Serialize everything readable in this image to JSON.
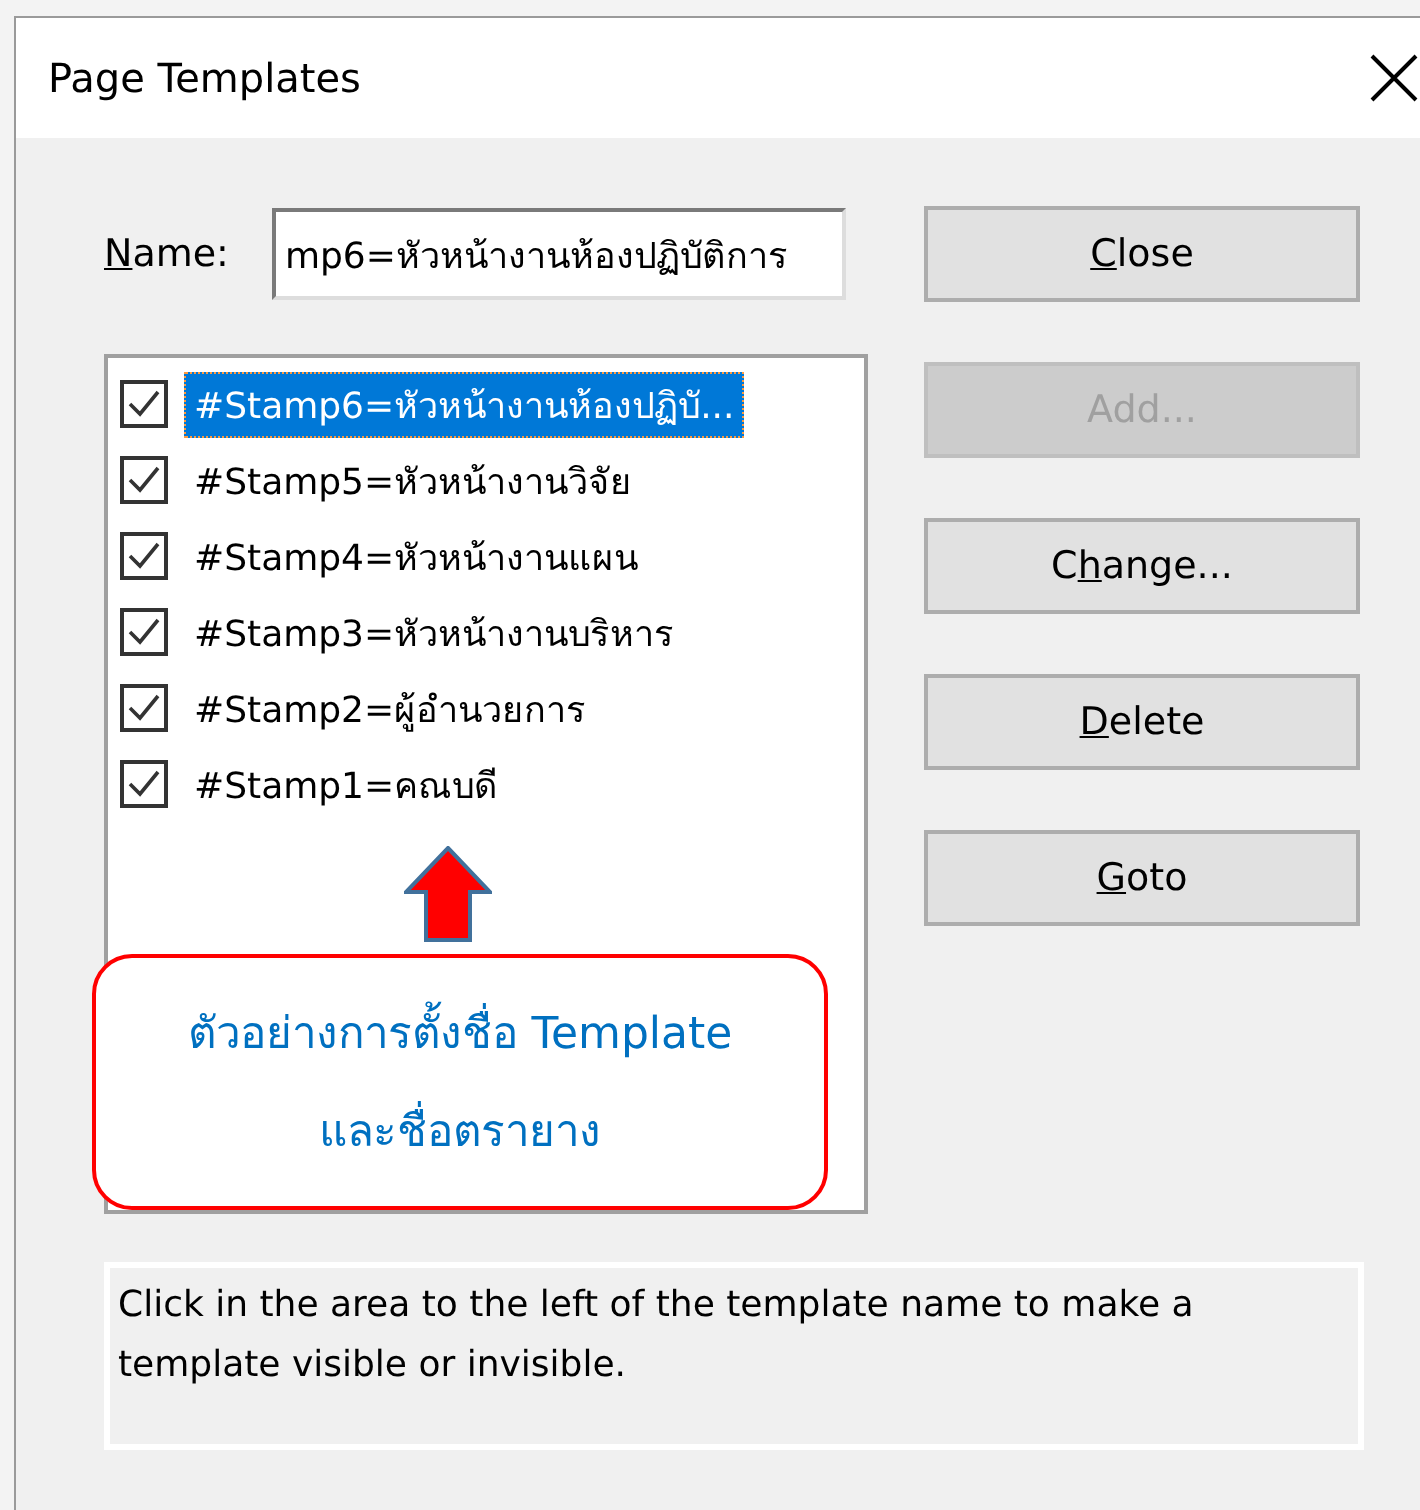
{
  "window": {
    "title": "Page Templates"
  },
  "name_field": {
    "label_parts": [
      {
        "text": "N",
        "underlined": true
      },
      {
        "text": "ame:",
        "underlined": false
      }
    ],
    "value": "mp6=หัวหน้างานห้องปฏิบัติการ"
  },
  "templates": [
    {
      "label": "#Stamp6=หัวหน้างานห้องปฏิบั...",
      "checked": true,
      "selected": true
    },
    {
      "label": "#Stamp5=หัวหน้างานวิจัย",
      "checked": true,
      "selected": false
    },
    {
      "label": "#Stamp4=หัวหน้างานแผน",
      "checked": true,
      "selected": false
    },
    {
      "label": "#Stamp3=หัวหน้างานบริหาร",
      "checked": true,
      "selected": false
    },
    {
      "label": "#Stamp2=ผู้อำนวยการ",
      "checked": true,
      "selected": false
    },
    {
      "label": "#Stamp1=คณบดี",
      "checked": true,
      "selected": false
    }
  ],
  "buttons": [
    {
      "label_parts": [
        {
          "text": "C",
          "underlined": true
        },
        {
          "text": "lose",
          "underlined": false
        }
      ],
      "disabled": false
    },
    {
      "label_parts": [
        {
          "text": "Add...",
          "underlined": false
        }
      ],
      "disabled": true
    },
    {
      "label_parts": [
        {
          "text": "C",
          "underlined": false
        },
        {
          "text": "h",
          "underlined": true
        },
        {
          "text": "ange...",
          "underlined": false
        }
      ],
      "disabled": false
    },
    {
      "label_parts": [
        {
          "text": "D",
          "underlined": true
        },
        {
          "text": "elete",
          "underlined": false
        }
      ],
      "disabled": false
    },
    {
      "label_parts": [
        {
          "text": "G",
          "underlined": true
        },
        {
          "text": "oto",
          "underlined": false
        }
      ],
      "disabled": false
    }
  ],
  "annotation": {
    "lines": [
      "ตัวอย่างการตั้งชื่อ Template",
      "และชื่อตรายาง"
    ]
  },
  "help_text": "Click in the area to the left of the template name to make a template visible or invisible."
}
